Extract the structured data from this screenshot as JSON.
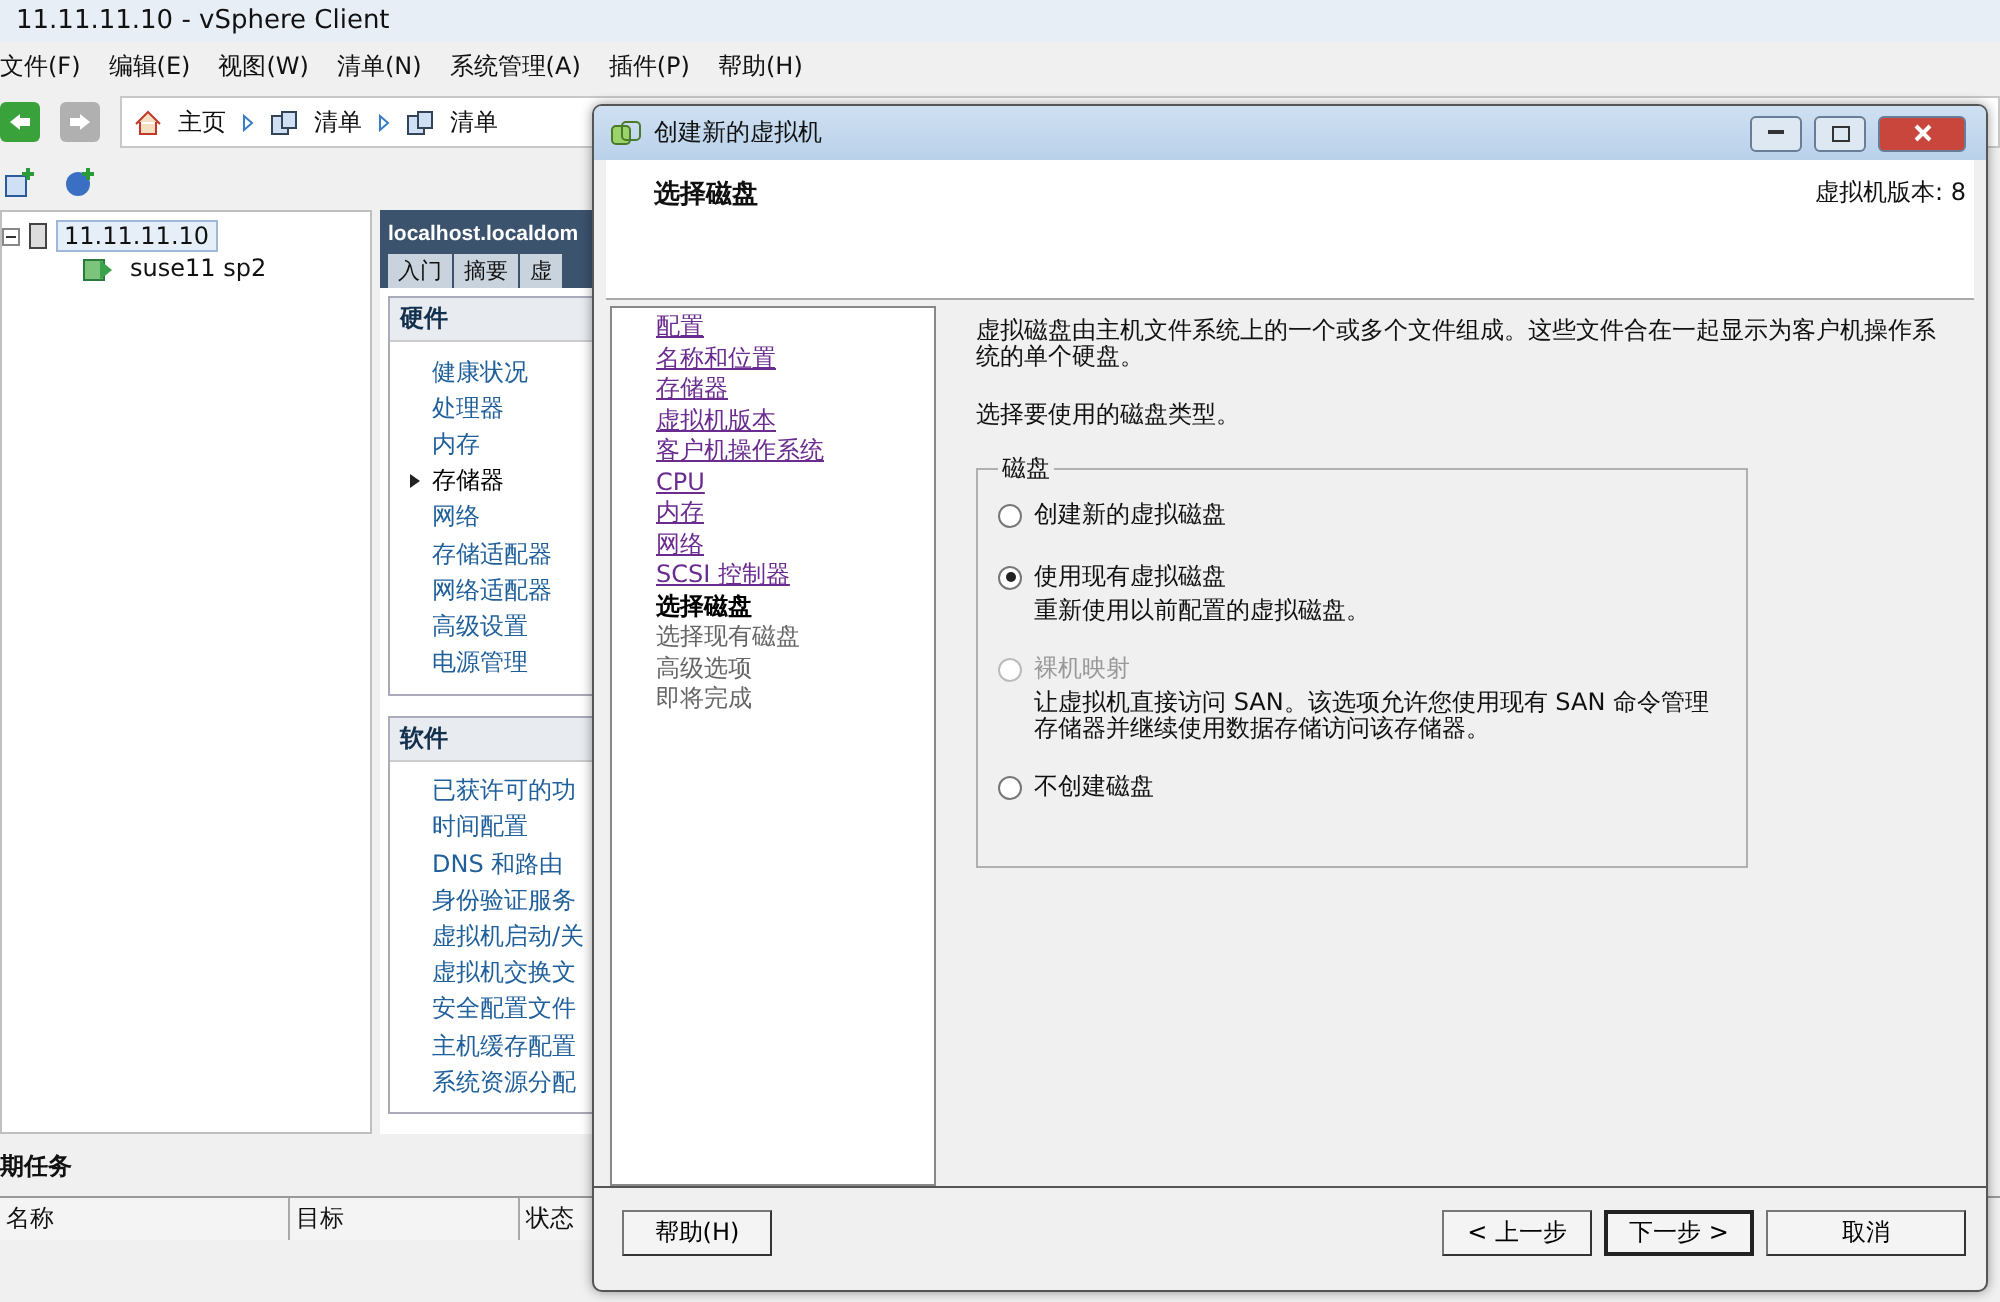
{
  "window": {
    "title": "11.11.11.10 - vSphere Client"
  },
  "menu": [
    "文件(F)",
    "编辑(E)",
    "视图(W)",
    "清单(N)",
    "系统管理(A)",
    "插件(P)",
    "帮助(H)"
  ],
  "breadcrumb": [
    "主页",
    "清单",
    "清单"
  ],
  "tree": [
    {
      "label": "11.11.11.10",
      "selected": true,
      "expanded": true,
      "children": [
        {
          "label": "suse11 sp2",
          "selected": false
        }
      ]
    }
  ],
  "host_panel": {
    "title": "localhost.localdom",
    "tabs": [
      {
        "label": "入门",
        "selected": false
      },
      {
        "label": "摘要",
        "selected": false
      },
      {
        "label": "虚",
        "selected": false
      }
    ],
    "sections": [
      {
        "title": "硬件",
        "items": [
          {
            "label": "健康状况",
            "selected": false
          },
          {
            "label": "处理器",
            "selected": false
          },
          {
            "label": "内存",
            "selected": false
          },
          {
            "label": "存储器",
            "selected": true
          },
          {
            "label": "网络",
            "selected": false
          },
          {
            "label": "存储适配器",
            "selected": false
          },
          {
            "label": "网络适配器",
            "selected": false
          },
          {
            "label": "高级设置",
            "selected": false
          },
          {
            "label": "电源管理",
            "selected": false
          }
        ]
      },
      {
        "title": "软件",
        "items": [
          {
            "label": "已获许可的功",
            "selected": false
          },
          {
            "label": "时间配置",
            "selected": false
          },
          {
            "label": "DNS 和路由",
            "selected": false
          },
          {
            "label": "身份验证服务",
            "selected": false
          },
          {
            "label": "虚拟机启动/关",
            "selected": false
          },
          {
            "label": "虚拟机交换文",
            "selected": false
          },
          {
            "label": "安全配置文件",
            "selected": false
          },
          {
            "label": "主机缓存配置",
            "selected": false
          },
          {
            "label": "系统资源分配",
            "selected": false
          }
        ]
      }
    ]
  },
  "recent_tasks": {
    "title": "期任务",
    "columns": [
      "名称",
      "目标",
      "状态"
    ]
  },
  "dialog": {
    "title": "创建新的虚拟机",
    "heading": "选择磁盘",
    "version": "虚拟机版本: 8",
    "steps": [
      {
        "label": "配置",
        "kind": "done"
      },
      {
        "label": "名称和位置",
        "kind": "done"
      },
      {
        "label": "存储器",
        "kind": "done"
      },
      {
        "label": "虚拟机版本",
        "kind": "done"
      },
      {
        "label": "客户机操作系统",
        "kind": "done"
      },
      {
        "label": "CPU",
        "kind": "done"
      },
      {
        "label": "内存",
        "kind": "done"
      },
      {
        "label": "网络",
        "kind": "done"
      },
      {
        "label": "SCSI 控制器",
        "kind": "done"
      },
      {
        "label": "选择磁盘",
        "kind": "current"
      },
      {
        "label": "选择现有磁盘",
        "kind": "pending"
      },
      {
        "label": "高级选项",
        "kind": "pending"
      },
      {
        "label": "即将完成",
        "kind": "pending"
      }
    ],
    "intro": "虚拟磁盘由主机文件系统上的一个或多个文件组成。这些文件合在一起显示为客户机操作系统的单个硬盘。",
    "prompt": "选择要使用的磁盘类型。",
    "group": {
      "title": "磁盘",
      "options": [
        {
          "label": "创建新的虚拟磁盘",
          "selected": false,
          "disabled": false
        },
        {
          "label": "使用现有虚拟磁盘",
          "description": "重新使用以前配置的虚拟磁盘。",
          "selected": true,
          "disabled": false
        },
        {
          "label": "裸机映射",
          "description": "让虚拟机直接访问 SAN。该选项允许您使用现有 SAN 命令管理存储器并继续使用数据存储访问该存储器。",
          "selected": false,
          "disabled": true
        },
        {
          "label": "不创建磁盘",
          "selected": false,
          "disabled": false
        }
      ]
    },
    "buttons": {
      "help": "帮助(H)",
      "back": "< 上一步",
      "next": "下一步 >",
      "cancel": "取消"
    }
  }
}
